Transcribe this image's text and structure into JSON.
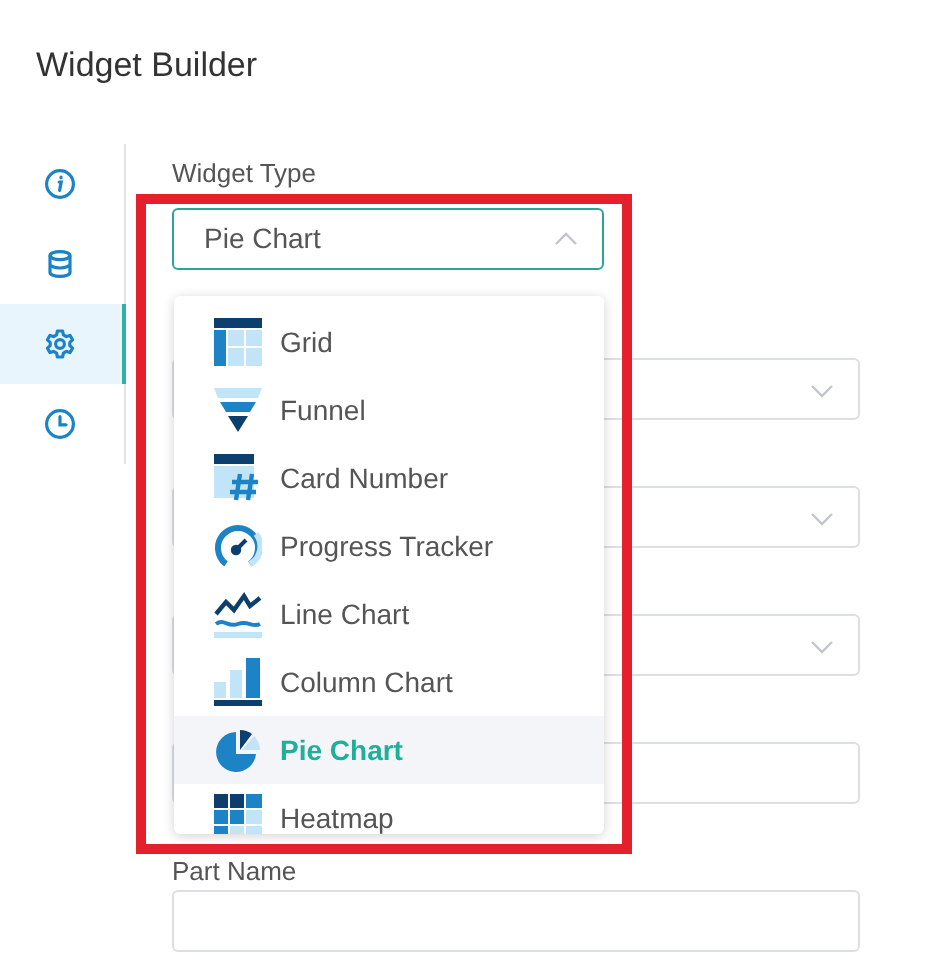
{
  "title": "Widget Builder",
  "sidebar": {
    "items": [
      {
        "selected": false
      },
      {
        "selected": false
      },
      {
        "selected": true
      },
      {
        "selected": false
      }
    ]
  },
  "widget_type": {
    "label": "Widget Type",
    "value": "Pie Chart",
    "expanded": true,
    "options": [
      {
        "label": "Grid",
        "selected": false
      },
      {
        "label": "Funnel",
        "selected": false
      },
      {
        "label": "Card Number",
        "selected": false
      },
      {
        "label": "Progress Tracker",
        "selected": false
      },
      {
        "label": "Line Chart",
        "selected": false
      },
      {
        "label": "Column Chart",
        "selected": false
      },
      {
        "label": "Pie Chart",
        "selected": true
      },
      {
        "label": "Heatmap",
        "selected": false
      }
    ]
  },
  "fields": [
    {
      "kind": "select"
    },
    {
      "kind": "select"
    },
    {
      "kind": "select"
    },
    {
      "kind": "input"
    },
    {
      "kind": "input",
      "label": "Part Name"
    }
  ]
}
